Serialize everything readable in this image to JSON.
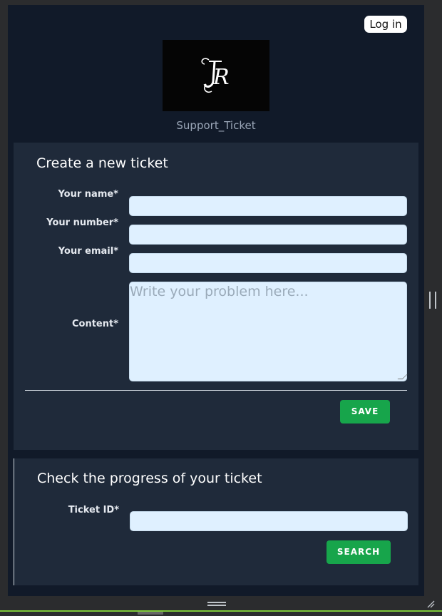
{
  "header": {
    "login_label": "Log in",
    "site_name": "Support_Ticket",
    "logo_alt": "JR"
  },
  "create_ticket": {
    "title": "Create a new ticket",
    "fields": {
      "name_label": "Your name*",
      "number_label": "Your number*",
      "email_label": "Your email*",
      "content_label": "Content*",
      "content_placeholder": "Write your problem here..."
    },
    "save_label": "SAVE"
  },
  "check_ticket": {
    "title": "Check the progress of your ticket",
    "ticket_id_label": "Ticket ID*",
    "search_label": "SEARCH"
  },
  "colors": {
    "page_bg": "#111a29",
    "card_bg": "#1f2a3a",
    "input_bg": "#dff0ff",
    "accent_green": "#17a54b"
  }
}
